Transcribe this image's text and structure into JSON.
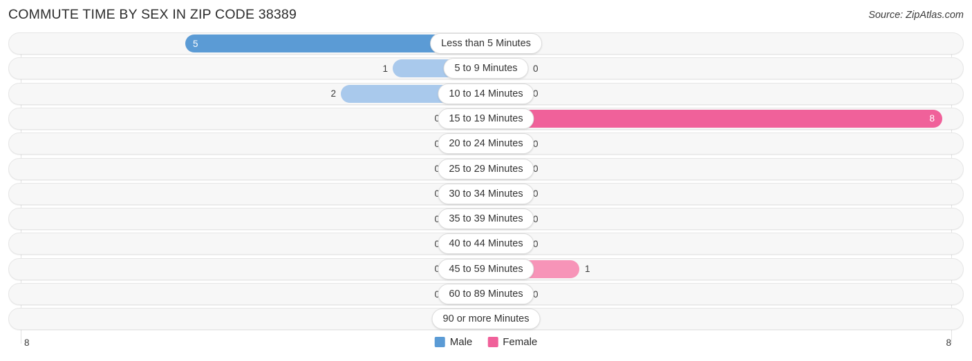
{
  "header": {
    "title": "COMMUTE TIME BY SEX IN ZIP CODE 38389",
    "source": "Source: ZipAtlas.com"
  },
  "axis": {
    "left_label": "8",
    "right_label": "8"
  },
  "legend": {
    "items": [
      {
        "label": "Male",
        "color": "#5b9bd5"
      },
      {
        "label": "Female",
        "color": "#f0619a"
      }
    ]
  },
  "colors": {
    "male_strong": "#5b9bd5",
    "male_light": "#a9c9ec",
    "female_strong": "#f0619a",
    "female_light": "#f794b8",
    "track": "#f7f7f7",
    "gridline": "#e2e2e2"
  },
  "chart_data": {
    "type": "bar",
    "subtype": "diverging-horizontal",
    "title": "COMMUTE TIME BY SEX IN ZIP CODE 38389",
    "xlabel": "",
    "ylabel": "",
    "xlim": [
      8,
      8
    ],
    "axis_max": 8,
    "grid": true,
    "legend_position": "bottom-center",
    "categories": [
      "Less than 5 Minutes",
      "5 to 9 Minutes",
      "10 to 14 Minutes",
      "15 to 19 Minutes",
      "20 to 24 Minutes",
      "25 to 29 Minutes",
      "30 to 34 Minutes",
      "35 to 39 Minutes",
      "40 to 44 Minutes",
      "45 to 59 Minutes",
      "60 to 89 Minutes",
      "90 or more Minutes"
    ],
    "series": [
      {
        "name": "Male",
        "direction": "left",
        "values": [
          5,
          1,
          2,
          0,
          0,
          0,
          0,
          0,
          0,
          0,
          0,
          0
        ]
      },
      {
        "name": "Female",
        "direction": "right",
        "values": [
          0,
          0,
          0,
          8,
          0,
          0,
          0,
          0,
          0,
          1,
          0,
          0
        ]
      }
    ]
  },
  "rows": [
    {
      "label": "Less than 5 Minutes",
      "male": "5",
      "female": "0"
    },
    {
      "label": "5 to 9 Minutes",
      "male": "1",
      "female": "0"
    },
    {
      "label": "10 to 14 Minutes",
      "male": "2",
      "female": "0"
    },
    {
      "label": "15 to 19 Minutes",
      "male": "0",
      "female": "8"
    },
    {
      "label": "20 to 24 Minutes",
      "male": "0",
      "female": "0"
    },
    {
      "label": "25 to 29 Minutes",
      "male": "0",
      "female": "0"
    },
    {
      "label": "30 to 34 Minutes",
      "male": "0",
      "female": "0"
    },
    {
      "label": "35 to 39 Minutes",
      "male": "0",
      "female": "0"
    },
    {
      "label": "40 to 44 Minutes",
      "male": "0",
      "female": "0"
    },
    {
      "label": "45 to 59 Minutes",
      "male": "0",
      "female": "1"
    },
    {
      "label": "60 to 89 Minutes",
      "male": "0",
      "female": "0"
    },
    {
      "label": "90 or more Minutes",
      "male": "0",
      "female": "0"
    }
  ]
}
